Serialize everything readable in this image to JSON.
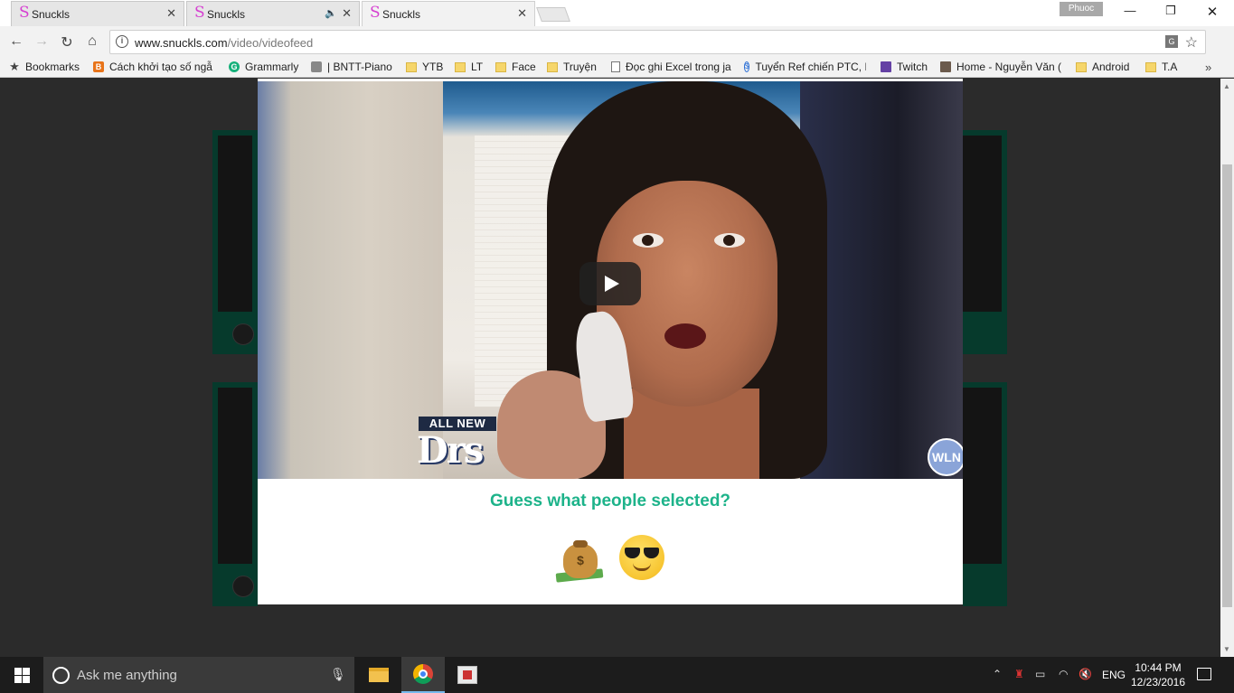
{
  "browser": {
    "tabs": [
      {
        "title": "Snuckls",
        "favicon": "S"
      },
      {
        "title": "Snuckls",
        "favicon": "S"
      },
      {
        "title": "Snuckls",
        "favicon": "S"
      }
    ],
    "profile_name": "Phuoc",
    "address": {
      "host": "www.snuckls.com",
      "path": "/video/videofeed"
    },
    "bookmarks": [
      {
        "label": "Bookmarks",
        "icon": "star-icon"
      },
      {
        "label": "Cách khởi tạo số ngẫ",
        "icon": "blogger-icon"
      },
      {
        "label": "Grammarly",
        "icon": "grammarly-icon"
      },
      {
        "label": "| BNTT-Piano",
        "icon": "site-icon"
      },
      {
        "label": "YTB",
        "icon": "folder-icon"
      },
      {
        "label": "LT",
        "icon": "folder-icon"
      },
      {
        "label": "Face",
        "icon": "folder-icon"
      },
      {
        "label": "Truyện",
        "icon": "folder-icon"
      },
      {
        "label": "Đọc ghi Excel trong ja",
        "icon": "document-icon"
      },
      {
        "label": "Tuyển Ref chiến PTC, I",
        "icon": "site-icon"
      },
      {
        "label": "Twitch",
        "icon": "twitch-icon"
      },
      {
        "label": "Home - Nguyễn Văn (",
        "icon": "avatar-icon"
      },
      {
        "label": "Android",
        "icon": "folder-icon"
      },
      {
        "label": "T.A",
        "icon": "folder-icon"
      }
    ]
  },
  "modal": {
    "video_badges": {
      "allnew": "ALL NEW",
      "show": "Drs",
      "network": "WLN"
    },
    "question": "Guess what people selected?",
    "choices": [
      {
        "icon": "money-bag-emoji"
      },
      {
        "icon": "sunglasses-face-emoji"
      }
    ]
  },
  "taskbar": {
    "search_placeholder": "Ask me anything",
    "language": "ENG",
    "time": "10:44 PM",
    "date": "12/23/2016"
  },
  "colors": {
    "accent": "#1db38a",
    "page_bg": "#2b2b2b",
    "card_border": "#063a2c"
  }
}
